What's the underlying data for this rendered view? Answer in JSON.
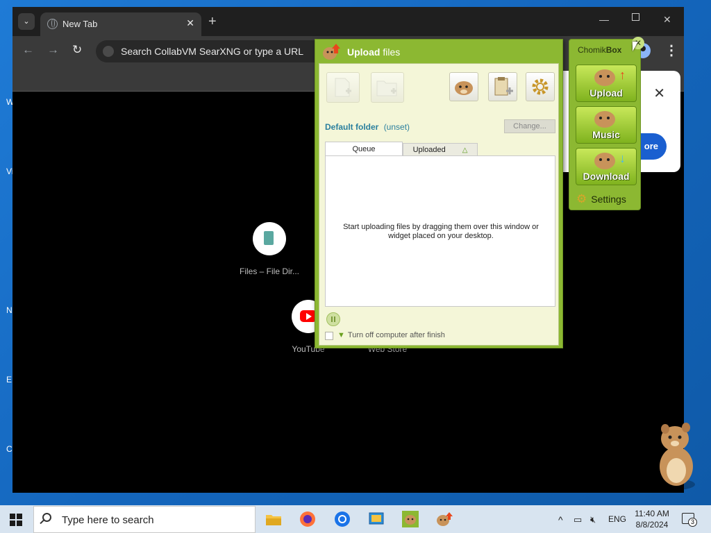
{
  "browser": {
    "tab_title": "New Tab",
    "omnibox_placeholder": "Search CollabVM SearXNG or type a URL",
    "shortcuts": [
      {
        "label": "Files – File Dir..."
      },
      {
        "label": "YouTube"
      },
      {
        "label": "Web Store"
      }
    ],
    "popup": {
      "more_label": "ore"
    }
  },
  "upload_window": {
    "title_bold": "Upload",
    "title_rest": " files",
    "default_folder_label": "Default folder",
    "default_folder_value": "(unset)",
    "change_button": "Change...",
    "tabs": {
      "queue": "Queue",
      "uploaded": "Uploaded"
    },
    "empty_message": "Start uploading files by dragging them over this window or widget placed on your desktop.",
    "shutdown_label": "Turn off computer after finish"
  },
  "chomikbox": {
    "brand_regular": "Chomik",
    "brand_bold": "Box",
    "buttons": [
      {
        "label": "Upload",
        "arrow": "↑",
        "arrow_color": "#e8471c"
      },
      {
        "label": "Music",
        "arrow": "",
        "arrow_color": "#000000"
      },
      {
        "label": "Download",
        "arrow": "↓",
        "arrow_color": "#4ab8e8"
      }
    ],
    "settings_label": "Settings"
  },
  "taskbar": {
    "search_placeholder": "Type here to search",
    "language": "ENG",
    "time": "11:40 AM",
    "date": "8/8/2024",
    "notification_count": "3"
  },
  "colors": {
    "chomik_green": "#8cb832",
    "window_bg": "#f4f6d8",
    "folder_link": "#2a7f9e"
  }
}
